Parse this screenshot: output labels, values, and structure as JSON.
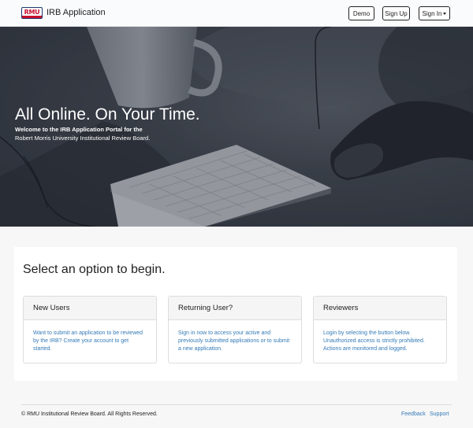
{
  "header": {
    "logo_text": "RMU",
    "app_name": "IRB Application",
    "buttons": {
      "demo": "Demo",
      "signup": "Sign Up",
      "signin": "Sign In"
    }
  },
  "hero": {
    "title": "All Online. On Your Time.",
    "subtitle_line1": "Welcome to the IRB Application Portal for the",
    "subtitle_line2": "Robert Morris University Institutional Review Board."
  },
  "main": {
    "heading": "Select an option to begin.",
    "cards": [
      {
        "title": "New Users",
        "text": "Want to submit an application to be reviewed by the IRB? Create your account to get started."
      },
      {
        "title": "Returning User?",
        "text": "Sign in now to access your active and previously submitted applications or to submit a new application."
      },
      {
        "title": "Reviewers",
        "text": "Login by selecting the button below. Unauthorized access is strictly prohibited. Actions are monitored and logged."
      }
    ]
  },
  "footer": {
    "copyright": "© RMU Institutional Review Board. All Rights Reserved.",
    "links": {
      "feedback": "Feedback",
      "support": "Support"
    }
  },
  "colors": {
    "link": "#337ab7",
    "logo_red": "#c8102e",
    "logo_navy": "#1d3a6e"
  }
}
